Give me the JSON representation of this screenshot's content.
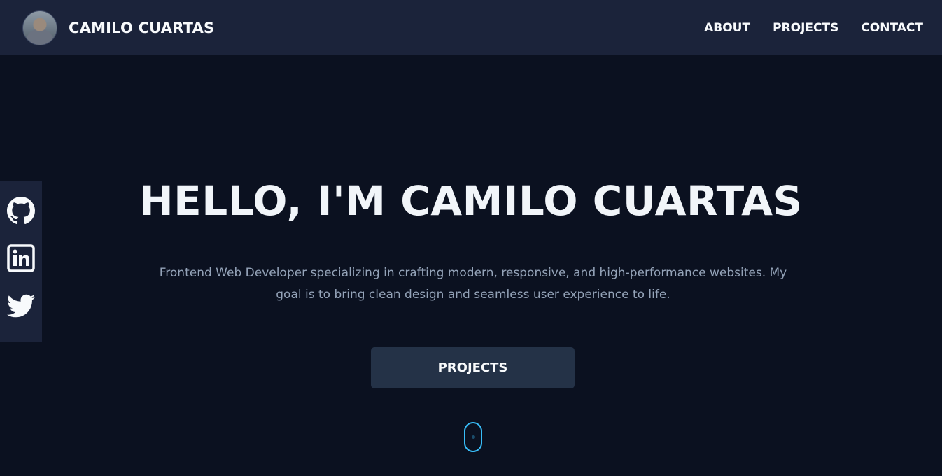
{
  "header": {
    "brand_name": "CAMILO CUARTAS",
    "nav": [
      {
        "label": "ABOUT"
      },
      {
        "label": "PROJECTS"
      },
      {
        "label": "CONTACT"
      }
    ]
  },
  "social": [
    {
      "icon": "github-icon"
    },
    {
      "icon": "linkedin-icon"
    },
    {
      "icon": "twitter-icon"
    }
  ],
  "hero": {
    "title": "HELLO, I'M CAMILO CUARTAS",
    "description": "Frontend Web Developer specializing in crafting modern, responsive, and high-performance websites. My goal is to bring clean design and seamless user experience to life.",
    "cta_label": "PROJECTS"
  },
  "colors": {
    "page_background": "#0b1120",
    "navbar_background": "#1b233a",
    "button_background": "#243247",
    "accent": "#38bdf8",
    "muted_text": "#94a3b8"
  }
}
